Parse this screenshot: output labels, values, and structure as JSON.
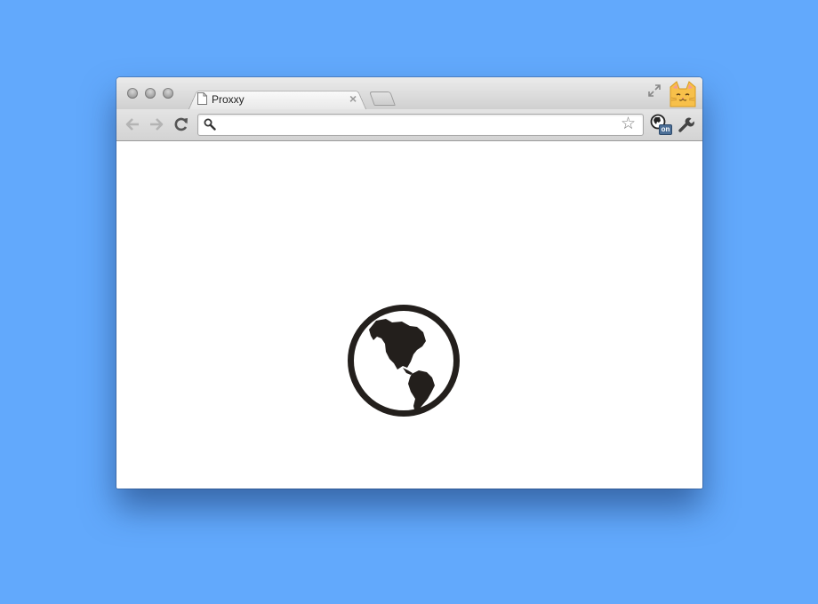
{
  "tab": {
    "title": "Proxxy",
    "close_label": "×"
  },
  "omnibox": {
    "value": "",
    "placeholder": ""
  },
  "extension": {
    "badge": "on"
  },
  "colors": {
    "background": "#62a9fc",
    "globe": "#231f1c"
  },
  "icons": {
    "window_controls": [
      "close-light",
      "minimize-light",
      "zoom-light"
    ],
    "tab_favicon": "page-icon",
    "titlebar_right": [
      "fullscreen-icon",
      "cat-avatar-icon"
    ],
    "toolbar": [
      "back-arrow-icon",
      "forward-arrow-icon",
      "reload-icon",
      "search-icon",
      "star-icon",
      "proxy-extension-icon",
      "wrench-icon"
    ],
    "content": "globe-americas-icon"
  }
}
